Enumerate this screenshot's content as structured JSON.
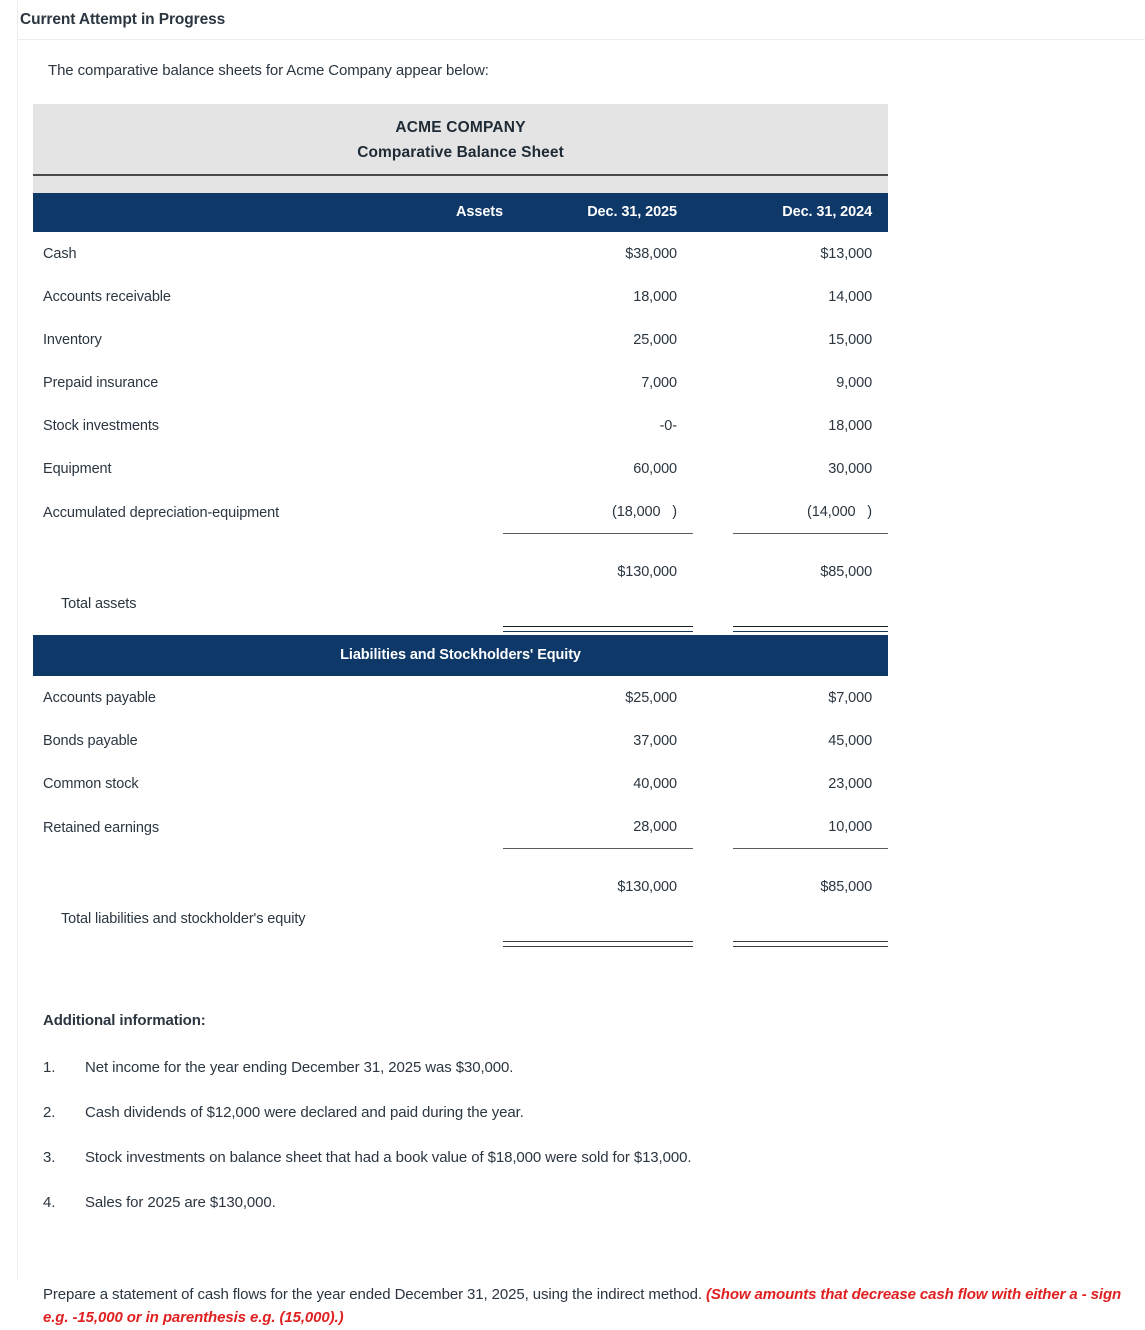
{
  "header": {
    "title": "Current Attempt in Progress"
  },
  "intro": "The comparative balance sheets for Acme Company appear below:",
  "statement": {
    "company_name": "ACME COMPANY",
    "statement_title": "Comparative Balance Sheet",
    "accent_color": "#0d3868",
    "title_bg_color": "#e4e4e4",
    "columns": {
      "label": "Assets",
      "year1": "Dec. 31, 2025",
      "year2": "Dec. 31, 2024"
    },
    "assets": [
      {
        "label": "Cash",
        "y1": "$38,000",
        "y2": "$13,000"
      },
      {
        "label": "Accounts receivable",
        "y1": "18,000",
        "y2": "14,000"
      },
      {
        "label": "Inventory",
        "y1": "25,000",
        "y2": "15,000"
      },
      {
        "label": "Prepaid insurance",
        "y1": "7,000",
        "y2": "9,000"
      },
      {
        "label": "Stock investments",
        "y1": "-0-",
        "y2": "18,000"
      },
      {
        "label": "Equipment",
        "y1": "60,000",
        "y2": "30,000"
      },
      {
        "label": "Accumulated depreciation-equipment",
        "y1": "(18,000   )",
        "y2": "(14,000   )"
      }
    ],
    "assets_total": {
      "label": "Total assets",
      "y1": "$130,000",
      "y2": "$85,000"
    },
    "liabilities_section_title": "Liabilities and Stockholders' Equity",
    "liabilities": [
      {
        "label": "Accounts payable",
        "y1": "$25,000",
        "y2": "$7,000"
      },
      {
        "label": "Bonds payable",
        "y1": "37,000",
        "y2": "45,000"
      },
      {
        "label": "Common stock",
        "y1": "40,000",
        "y2": "23,000"
      },
      {
        "label": "Retained earnings",
        "y1": "28,000",
        "y2": "10,000"
      }
    ],
    "liabilities_total": {
      "label": "Total liabilities and stockholder's equity",
      "y1": "$130,000",
      "y2": "$85,000"
    }
  },
  "additional": {
    "title": "Additional information:",
    "items": [
      {
        "num": "1.",
        "text": "Net income for the year ending December 31, 2025 was $30,000."
      },
      {
        "num": "2.",
        "text": "Cash dividends of $12,000 were declared and paid during the year."
      },
      {
        "num": "3.",
        "text": "Stock investments on balance sheet that had a book value of $18,000 were sold for $13,000."
      },
      {
        "num": "4.",
        "text": "Sales for 2025 are $130,000."
      }
    ]
  },
  "prompt": {
    "text": "Prepare a statement of cash flows for the year ended December 31, 2025, using the indirect method. ",
    "emphasis": "(Show amounts that decrease cash flow with either a - sign e.g. -15,000 or in parenthesis e.g. (15,000).)",
    "emphasis_color": "#e02020"
  }
}
